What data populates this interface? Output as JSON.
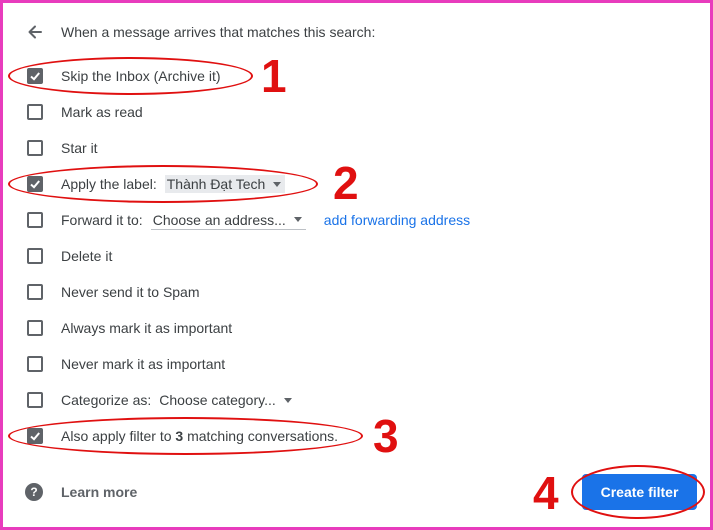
{
  "header": {
    "text": "When a message arrives that matches this search:"
  },
  "options": {
    "skip_inbox": {
      "label": "Skip the Inbox (Archive it)",
      "checked": true
    },
    "mark_read": {
      "label": "Mark as read",
      "checked": false
    },
    "star": {
      "label": "Star it",
      "checked": false
    },
    "apply_label": {
      "label": "Apply the label:",
      "checked": true,
      "value": "Thành Đạt Tech"
    },
    "forward": {
      "label": "Forward it to:",
      "checked": false,
      "placeholder": "Choose an address...",
      "link": "add forwarding address"
    },
    "delete": {
      "label": "Delete it",
      "checked": false
    },
    "never_spam": {
      "label": "Never send it to Spam",
      "checked": false
    },
    "always_important": {
      "label": "Always mark it as important",
      "checked": false
    },
    "never_important": {
      "label": "Never mark it as important",
      "checked": false
    },
    "categorize": {
      "label": "Categorize as:",
      "checked": false,
      "placeholder": "Choose category..."
    },
    "also_apply": {
      "label_pre": "Also apply filter to ",
      "count": "3",
      "label_post": " matching conversations.",
      "checked": true
    }
  },
  "footer": {
    "learn_more": "Learn more",
    "create_filter": "Create filter"
  },
  "annotations": {
    "n1": "1",
    "n2": "2",
    "n3": "3",
    "n4": "4"
  },
  "colors": {
    "accent": "#1a73e8",
    "annotation": "#e01010",
    "frame": "#e83cbd"
  }
}
